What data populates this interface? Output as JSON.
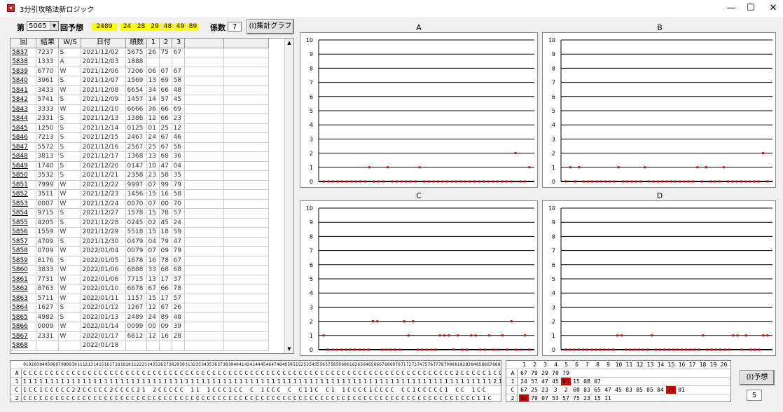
{
  "window": {
    "title": "3分引攻略法新ロジック",
    "minimize": "—",
    "maximize": "☐",
    "close": "✕"
  },
  "toolbar": {
    "draw_label": "第",
    "draw_value": "5065",
    "forecast_label": "回予想",
    "yellow_values": [
      "2489",
      "24",
      "28",
      "29",
      "48",
      "49",
      "89"
    ],
    "coef_label": "係数",
    "coef_value": "7",
    "graph_button": "(I)集計グラフ",
    "predict_button": "(I)予想",
    "predict_value": "5"
  },
  "table": {
    "headers": [
      "回",
      "結果",
      "W/S",
      "日付",
      "順数",
      "1",
      "2",
      "3"
    ],
    "rows": [
      [
        "5837",
        "7237",
        "S",
        "2021/12/02",
        "5675",
        "26",
        "75",
        "67"
      ],
      [
        "5838",
        "1333",
        "A",
        "2021/12/03",
        "1888",
        "",
        "",
        ""
      ],
      [
        "5839",
        "6770",
        "W",
        "2021/12/06",
        "7206",
        "06",
        "07",
        "67"
      ],
      [
        "5840",
        "3961",
        "S",
        "2021/12/07",
        "1569",
        "13",
        "69",
        "58"
      ],
      [
        "5841",
        "3433",
        "W",
        "2021/12/08",
        "6654",
        "34",
        "66",
        "48"
      ],
      [
        "5842",
        "5741",
        "S",
        "2021/12/09",
        "1457",
        "14",
        "57",
        "45"
      ],
      [
        "5843",
        "3333",
        "W",
        "2021/12/10",
        "6666",
        "36",
        "66",
        "69"
      ],
      [
        "5844",
        "2331",
        "S",
        "2021/12/13",
        "1386",
        "12",
        "66",
        "23"
      ],
      [
        "5845",
        "1250",
        "S",
        "2021/12/14",
        "0125",
        "01",
        "25",
        "12"
      ],
      [
        "5846",
        "7213",
        "S",
        "2021/12/15",
        "2467",
        "24",
        "67",
        "46"
      ],
      [
        "5847",
        "5572",
        "S",
        "2021/12/16",
        "2567",
        "25",
        "67",
        "56"
      ],
      [
        "5848",
        "3813",
        "S",
        "2021/12/17",
        "1368",
        "13",
        "68",
        "36"
      ],
      [
        "5849",
        "1740",
        "S",
        "2021/12/20",
        "0147",
        "10",
        "47",
        "04"
      ],
      [
        "5850",
        "3532",
        "S",
        "2021/12/21",
        "2358",
        "23",
        "58",
        "35"
      ],
      [
        "5851",
        "7999",
        "W",
        "2021/12/22",
        "9997",
        "07",
        "99",
        "79"
      ],
      [
        "5852",
        "3511",
        "W",
        "2021/12/23",
        "1456",
        "15",
        "16",
        "58"
      ],
      [
        "5853",
        "0007",
        "W",
        "2021/12/24",
        "0070",
        "07",
        "00",
        "70"
      ],
      [
        "5854",
        "9715",
        "S",
        "2021/12/27",
        "1578",
        "15",
        "78",
        "57"
      ],
      [
        "5855",
        "4205",
        "S",
        "2021/12/28",
        "0245",
        "02",
        "45",
        "24"
      ],
      [
        "5856",
        "1559",
        "W",
        "2021/12/29",
        "5518",
        "15",
        "18",
        "59"
      ],
      [
        "5857",
        "4709",
        "S",
        "2021/12/30",
        "0479",
        "04",
        "79",
        "47"
      ],
      [
        "5858",
        "0709",
        "W",
        "2022/01/04",
        "0079",
        "07",
        "09",
        "79"
      ],
      [
        "5859",
        "8176",
        "S",
        "2022/01/05",
        "1678",
        "16",
        "78",
        "67"
      ],
      [
        "5860",
        "3833",
        "W",
        "2022/01/06",
        "6888",
        "33",
        "68",
        "68"
      ],
      [
        "5861",
        "7731",
        "W",
        "2022/01/06",
        "7715",
        "13",
        "17",
        "37"
      ],
      [
        "5862",
        "8763",
        "W",
        "2022/01/10",
        "6678",
        "67",
        "66",
        "78"
      ],
      [
        "5863",
        "5711",
        "W",
        "2022/01/11",
        "1157",
        "15",
        "17",
        "57"
      ],
      [
        "5864",
        "1627",
        "S",
        "2022/01/12",
        "1267",
        "12",
        "67",
        "26"
      ],
      [
        "5865",
        "4982",
        "S",
        "2022/01/13",
        "2489",
        "24",
        "89",
        "48"
      ],
      [
        "5866",
        "0009",
        "W",
        "2022/01/14",
        "0099",
        "00",
        "09",
        "39"
      ],
      [
        "5867",
        "2331",
        "W",
        "2022/01/17",
        "6812",
        "12",
        "16",
        "28"
      ],
      [
        "5868",
        "",
        "",
        "2022/01/18",
        "",
        "",
        "",
        ""
      ]
    ]
  },
  "charts": {
    "y_ticks": [
      "10",
      "9",
      "8",
      "7",
      "6",
      "5",
      "4",
      "3",
      "2",
      "1",
      "0"
    ]
  },
  "chart_data": [
    {
      "type": "scatter",
      "title": "A",
      "ylim": [
        0,
        10
      ],
      "values": [
        0,
        0,
        0,
        0,
        0,
        0,
        0,
        0,
        0,
        0,
        1,
        0,
        0,
        0,
        1,
        0,
        0,
        0,
        0,
        0,
        0,
        1,
        0,
        0,
        0,
        0,
        0,
        0,
        0,
        0,
        0,
        0,
        0,
        0,
        0,
        0,
        0,
        0,
        0,
        0,
        0,
        0,
        2,
        0,
        0,
        1
      ]
    },
    {
      "type": "scatter",
      "title": "B",
      "ylim": [
        0,
        10
      ],
      "values": [
        0,
        1,
        0,
        1,
        0,
        0,
        0,
        0,
        0,
        0,
        0,
        0,
        1,
        0,
        0,
        0,
        0,
        0,
        1,
        0,
        0,
        0,
        0,
        0,
        0,
        0,
        0,
        0,
        0,
        0,
        1,
        0,
        1,
        0,
        0,
        0,
        1,
        0,
        0,
        0,
        0,
        0,
        0,
        0,
        0,
        2,
        0
      ]
    },
    {
      "type": "scatter",
      "title": "C",
      "ylim": [
        0,
        10
      ],
      "values": [
        1,
        0,
        0,
        0,
        0,
        0,
        0,
        0,
        0,
        0,
        0,
        2,
        2,
        0,
        0,
        0,
        0,
        0,
        2,
        1,
        2,
        0,
        0,
        0,
        0,
        0,
        1,
        1,
        1,
        0,
        1,
        0,
        0,
        1,
        1,
        0,
        0,
        1,
        0,
        0,
        1,
        0,
        2,
        0,
        0,
        1,
        0
      ]
    },
    {
      "type": "scatter",
      "title": "D",
      "ylim": [
        0,
        10
      ],
      "values": [
        0,
        0,
        0,
        0,
        0,
        0,
        0,
        0,
        0,
        0,
        0,
        0,
        1,
        1,
        0,
        0,
        0,
        0,
        0,
        0,
        1,
        0,
        0,
        0,
        0,
        0,
        0,
        0,
        0,
        0,
        0,
        0,
        1,
        0,
        0,
        0,
        0,
        0,
        0,
        1,
        1,
        0,
        1,
        0,
        0,
        0,
        1,
        1
      ]
    }
  ],
  "bottom_grid": {
    "header": [
      "01",
      "02",
      "03",
      "04",
      "05",
      "06",
      "07",
      "08",
      "09",
      "10",
      "11",
      "12",
      "13",
      "14",
      "15",
      "16",
      "17",
      "18",
      "19",
      "20",
      "21",
      "22",
      "23",
      "24",
      "25",
      "26",
      "27",
      "28",
      "29",
      "30",
      "31",
      "32",
      "33",
      "34",
      "35",
      "36",
      "37",
      "38",
      "39",
      "40",
      "41",
      "42",
      "43",
      "44",
      "45",
      "46",
      "47",
      "48",
      "49",
      "50",
      "51",
      "52",
      "53",
      "54",
      "55",
      "56",
      "57",
      "58",
      "59",
      "60",
      "61",
      "62",
      "63",
      "64",
      "65",
      "66",
      "67",
      "68",
      "69",
      "70",
      "71",
      "72",
      "73",
      "74",
      "75",
      "76",
      "77",
      "78",
      "79",
      "80",
      "81",
      "82",
      "83",
      "84",
      "85",
      "86",
      "87",
      "88",
      "89"
    ],
    "rows": [
      {
        "label": "A",
        "cells": "CCCCCCCCCCCCCCCCCCCCCCCCCCCCCCCCCCCCCCCCCCCCCCCCCCCCCCCCCCCCCCCCCCCCCCCCCCCCCCCC2CCCCC1CC"
      },
      {
        "label": "1",
        "cells": "11111111111111111111111111111111111111111111111111111111111111111111111111111111111111121"
      },
      {
        "label": "C",
        "cells": "1CC1CCCCC22CCCCC2CCCC21 2CCCCC 11 1CCC1CC C 1CCC C C11C C1 1CCCC1CCCC CC1CCCCC1 CC 1CC"
      },
      {
        "label": "2",
        "cells": "CCCCCCCCCCCCCCCCCCCCCCCCCCCCCCCCCCCCCCCCCCCCCCCCCCCCCCCCCCCCCCCCCCCCCCCCCCCCCCCCCCCC11C"
      }
    ]
  },
  "right_grid": {
    "header": [
      "1",
      "2",
      "3",
      "4",
      "5",
      "6",
      "7",
      "8",
      "9",
      "10",
      "11",
      "12",
      "13",
      "14",
      "15",
      "16",
      "17",
      "18",
      "19",
      "20"
    ],
    "rows": [
      {
        "label": "A",
        "text": "67 79 29 70 79"
      },
      {
        "label": "1",
        "text": "24 57 47 45 93 15 08 07",
        "red": "93"
      },
      {
        "label": "C",
        "text": "67 25 23 3 2 60 83 65 47 45 83 85 85 84 29 01",
        "red": "29"
      },
      {
        "label": "2",
        "text": "98 79 07 53 57 75 23 15 11",
        "red": "98"
      }
    ]
  }
}
